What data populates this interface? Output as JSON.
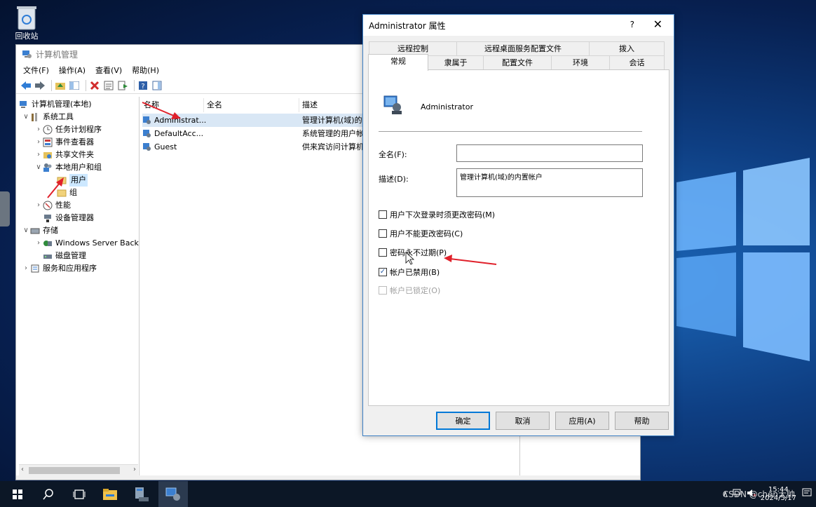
{
  "desktop": {
    "recycle_bin_label": "回收站"
  },
  "computer_management": {
    "title": "计算机管理",
    "menu": [
      "文件(F)",
      "操作(A)",
      "查看(V)",
      "帮助(H)"
    ],
    "tree": [
      {
        "label": "计算机管理(本地)"
      },
      {
        "label": "系统工具"
      },
      {
        "label": "任务计划程序"
      },
      {
        "label": "事件查看器"
      },
      {
        "label": "共享文件夹"
      },
      {
        "label": "本地用户和组"
      },
      {
        "label": "用户"
      },
      {
        "label": "组"
      },
      {
        "label": "性能"
      },
      {
        "label": "设备管理器"
      },
      {
        "label": "存储"
      },
      {
        "label": "Windows Server Back"
      },
      {
        "label": "磁盘管理"
      },
      {
        "label": "服务和应用程序"
      }
    ],
    "columns": [
      "名称",
      "全名",
      "描述"
    ],
    "rows": [
      {
        "name": "Administrat...",
        "full_name": "",
        "description": "管理计算机(域)的"
      },
      {
        "name": "DefaultAcc...",
        "full_name": "",
        "description": "系统管理的用户帐"
      },
      {
        "name": "Guest",
        "full_name": "",
        "description": "供来宾访问计算机"
      }
    ]
  },
  "dialog": {
    "title": "Administrator 属性",
    "help": "?",
    "close": "✕",
    "tabs_row1": [
      "远程控制",
      "远程桌面服务配置文件",
      "拨入"
    ],
    "tabs_row2": [
      "常规",
      "隶属于",
      "配置文件",
      "环境",
      "会话"
    ],
    "user_name": "Administrator",
    "full_name_label": "全名(F):",
    "full_name_value": "",
    "description_label": "描述(D):",
    "description_value": "管理计算机(域)的内置帐户",
    "checkboxes": [
      {
        "label": "用户下次登录时须更改密码(M)",
        "checked": false
      },
      {
        "label": "用户不能更改密码(C)",
        "checked": false
      },
      {
        "label": "密码永不过期(P)",
        "checked": false
      },
      {
        "label": "帐户已禁用(B)",
        "checked": true
      },
      {
        "label": "帐户已锁定(O)",
        "checked": false,
        "disabled": true
      }
    ],
    "buttons": {
      "ok": "确定",
      "cancel": "取消",
      "apply": "应用(A)",
      "help": "帮助"
    }
  },
  "taskbar": {
    "time": "15:44",
    "date": "2024/5/17",
    "watermark": "CSDN @chen大帅",
    "tray_caret": "∧"
  },
  "colors": {
    "accent": "#0078d7",
    "annotation_arrow": "#e0212b",
    "taskbar": "#0c1726"
  }
}
